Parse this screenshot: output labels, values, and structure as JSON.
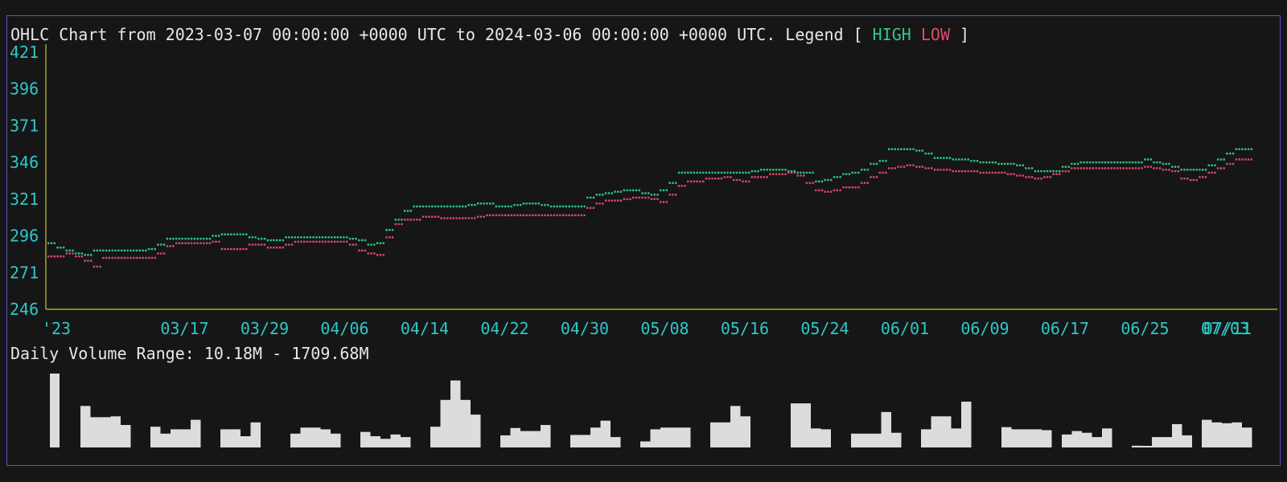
{
  "header": {
    "title": "OHLC Chart from 2023-03-07 00:00:00 +0000 UTC to 2024-03-06 00:00:00 +0000 UTC. Legend [ ",
    "legend_high": "HIGH",
    "legend_low": "LOW",
    "legend_close": " ]"
  },
  "volume": {
    "caption": "Daily Volume Range: 10.18M - 1709.68M"
  },
  "colors": {
    "background": "#161616",
    "frame": "#5a55c8",
    "axis": "#c8c83c",
    "tick": "#2ec8c8",
    "high": "#2ec88a",
    "low": "#e04a6a",
    "text": "#e8e8e8",
    "volume_bar": "#dcdcdc"
  },
  "chart_data": {
    "type": "line",
    "y_ticks": [
      "421",
      "396",
      "371",
      "346",
      "321",
      "296",
      "271",
      "246"
    ],
    "ylim": [
      246,
      421
    ],
    "x_ticks": [
      "'23",
      "03/17",
      "03/29",
      "04/06",
      "04/14",
      "04/22",
      "04/30",
      "05/08",
      "05/16",
      "05/24",
      "06/01",
      "06/09",
      "06/17",
      "06/25",
      "07/03",
      "07/11"
    ],
    "legend": "top",
    "series": [
      {
        "name": "HIGH",
        "values": [
          291,
          288,
          286,
          284,
          283,
          286,
          286,
          286,
          286,
          286,
          286,
          287,
          290,
          294,
          294,
          294,
          294,
          294,
          296,
          297,
          297,
          297,
          295,
          294,
          293,
          293,
          295,
          295,
          295,
          295,
          295,
          295,
          295,
          294,
          293,
          290,
          291,
          300,
          307,
          313,
          316,
          316,
          316,
          316,
          316,
          316,
          317,
          318,
          318,
          316,
          316,
          317,
          318,
          318,
          317,
          316,
          316,
          316,
          316,
          322,
          324,
          325,
          326,
          327,
          327,
          325,
          324,
          327,
          332,
          339,
          339,
          339,
          339,
          339,
          339,
          339,
          339,
          340,
          341,
          341,
          341,
          340,
          339,
          339,
          333,
          334,
          336,
          338,
          339,
          341,
          345,
          347,
          355,
          355,
          355,
          354,
          352,
          349,
          349,
          348,
          348,
          347,
          346,
          346,
          345,
          345,
          344,
          342,
          340,
          340,
          340,
          343,
          345,
          346,
          346,
          346,
          346,
          346,
          346,
          346,
          348,
          346,
          345,
          343,
          341,
          341,
          341,
          344,
          348,
          352,
          355,
          355
        ]
      },
      {
        "name": "LOW",
        "values": [
          282,
          282,
          284,
          282,
          279,
          275,
          281,
          281,
          281,
          281,
          281,
          281,
          284,
          289,
          291,
          291,
          291,
          291,
          292,
          287,
          287,
          287,
          290,
          290,
          288,
          288,
          290,
          292,
          292,
          292,
          292,
          292,
          292,
          290,
          286,
          284,
          283,
          295,
          304,
          307,
          307,
          309,
          309,
          308,
          308,
          308,
          308,
          309,
          310,
          310,
          310,
          310,
          310,
          310,
          310,
          310,
          310,
          310,
          310,
          315,
          318,
          320,
          320,
          321,
          322,
          322,
          321,
          319,
          324,
          330,
          333,
          333,
          335,
          335,
          336,
          334,
          333,
          336,
          336,
          338,
          338,
          339,
          337,
          332,
          327,
          326,
          327,
          329,
          329,
          332,
          336,
          339,
          342,
          343,
          344,
          343,
          342,
          341,
          341,
          340,
          340,
          340,
          339,
          339,
          339,
          338,
          337,
          336,
          335,
          336,
          338,
          340,
          342,
          342,
          342,
          342,
          342,
          342,
          342,
          342,
          343,
          342,
          341,
          340,
          335,
          334,
          336,
          339,
          342,
          345,
          348,
          348
        ]
      }
    ],
    "volume": {
      "label": "Daily Volume Range: 10.18M - 1709.68M",
      "groups": [
        [
          1709.68
        ],
        [
          960,
          700,
          700,
          720,
          520
        ],
        [
          480,
          320,
          420,
          420,
          640
        ],
        [
          420,
          420,
          260,
          580
        ],
        [
          320,
          460,
          460,
          420,
          320
        ],
        [
          360,
          260,
          200,
          300,
          240
        ],
        [
          480,
          1100,
          1550,
          1100,
          760
        ],
        [
          280,
          450,
          380,
          380,
          520
        ],
        [
          290,
          290,
          460,
          620,
          240
        ],
        [
          140,
          420,
          460,
          460,
          460
        ],
        [
          580,
          580,
          960,
          720
        ],
        [
          1020,
          1020,
          440,
          420
        ],
        [
          320,
          320,
          320,
          820,
          340
        ],
        [
          420,
          720,
          720,
          440,
          1060
        ],
        [
          470,
          420,
          420,
          420,
          400
        ],
        [
          300,
          380,
          340,
          240,
          440
        ],
        [
          40,
          10.18
        ],
        [
          240,
          240,
          540,
          280
        ],
        [
          640,
          580,
          560,
          580,
          460
        ]
      ]
    }
  }
}
